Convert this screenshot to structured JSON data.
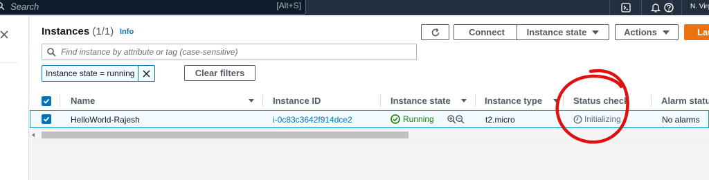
{
  "topbar": {
    "search_placeholder": "Search",
    "search_shortcut": "[Alt+S]",
    "region": "N. Virg"
  },
  "panel": {
    "title": "Instances",
    "count": "(1/1)",
    "info": "Info",
    "filter_placeholder": "Find instance by attribute or tag (case-sensitive)",
    "active_filter": "Instance state = running",
    "clear_filters": "Clear filters"
  },
  "toolbar": {
    "connect": "Connect",
    "instance_state": "Instance state",
    "actions": "Actions",
    "launch": "Launch instances"
  },
  "table": {
    "columns": [
      "Name",
      "Instance ID",
      "Instance state",
      "Instance type",
      "Status check",
      "Alarm status"
    ],
    "rows": [
      {
        "name": "HelloWorld-Rajesh",
        "instance_id": "i-0c83c3642f914dce2",
        "state": "Running",
        "type": "t2.micro",
        "status_check": "Initializing",
        "alarm": "No alarms"
      }
    ]
  },
  "colors": {
    "nav_bg": "#232f3e",
    "link": "#0073bb",
    "running": "#1d8102",
    "primary_button": "#ec7211",
    "annotation_circle": "#e01010"
  },
  "annotation": "red-hand-drawn-circle-around-status-check"
}
